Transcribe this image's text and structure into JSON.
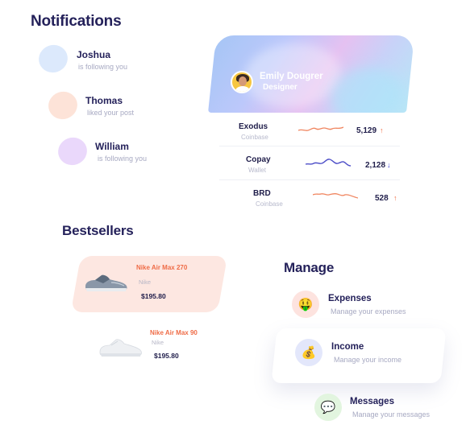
{
  "notifications": {
    "title": "Notifications",
    "items": [
      {
        "name": "Joshua",
        "text": "is following you",
        "color": "#dce9fc"
      },
      {
        "name": "Thomas",
        "text": "liked your post",
        "color": "#fde3d8"
      },
      {
        "name": "William",
        "text": "is following you",
        "color": "#ead8fb"
      }
    ]
  },
  "profile": {
    "name": "Emily Dougrer",
    "role": "Designer"
  },
  "wallets": [
    {
      "name": "Exodus",
      "source": "Coinbase",
      "value": "5,129",
      "trend": "↑",
      "trend_color": "#f06a3f",
      "line_color": "#f0855f"
    },
    {
      "name": "Copay",
      "source": "Wallet",
      "value": "2,128",
      "trend": "↓",
      "trend_color": "#3b3fd8",
      "line_color": "#4e4fc8"
    },
    {
      "name": "BRD",
      "source": "Coinbase",
      "value": "528",
      "trend": "↑",
      "trend_color": "#f06a3f",
      "line_color": "#f0855f"
    }
  ],
  "bestsellers": {
    "title": "Bestsellers",
    "items": [
      {
        "name": "Nike Air Max 270",
        "brand": "Nike",
        "price": "$195.80"
      },
      {
        "name": "Nike Air Max 90",
        "brand": "Nike",
        "price": "$195.80"
      }
    ]
  },
  "manage": {
    "title": "Manage",
    "items": [
      {
        "title": "Expenses",
        "subtitle": "Manage your expenses",
        "icon": "money-face-icon",
        "glyph": "🤑",
        "bg": "#fde3df"
      },
      {
        "title": "Income",
        "subtitle": "Manage your income",
        "icon": "money-bag-icon",
        "glyph": "💰",
        "bg": "#e3e7fb"
      },
      {
        "title": "Messages",
        "subtitle": "Manage your messages",
        "icon": "speech-bubble-icon",
        "glyph": "💬",
        "bg": "#e2f5df"
      }
    ]
  }
}
